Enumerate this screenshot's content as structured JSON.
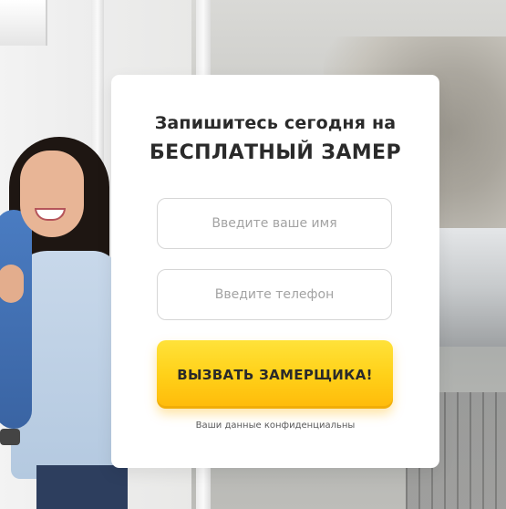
{
  "form": {
    "headline_line1": "Запишитесь сегодня на",
    "headline_line2": "БЕСПЛАТНЫЙ ЗАМЕР",
    "name_placeholder": "Введите ваше имя",
    "phone_placeholder": "Введите телефон",
    "submit_label": "ВЫЗВАТЬ ЗАМЕРЩИКА!",
    "privacy_note": "Ваши данные конфиденциальны"
  },
  "colors": {
    "button_top": "#ffe23a",
    "button_bottom": "#ffba0a",
    "card_background": "#ffffff",
    "text_dark": "#2a2a2a"
  }
}
